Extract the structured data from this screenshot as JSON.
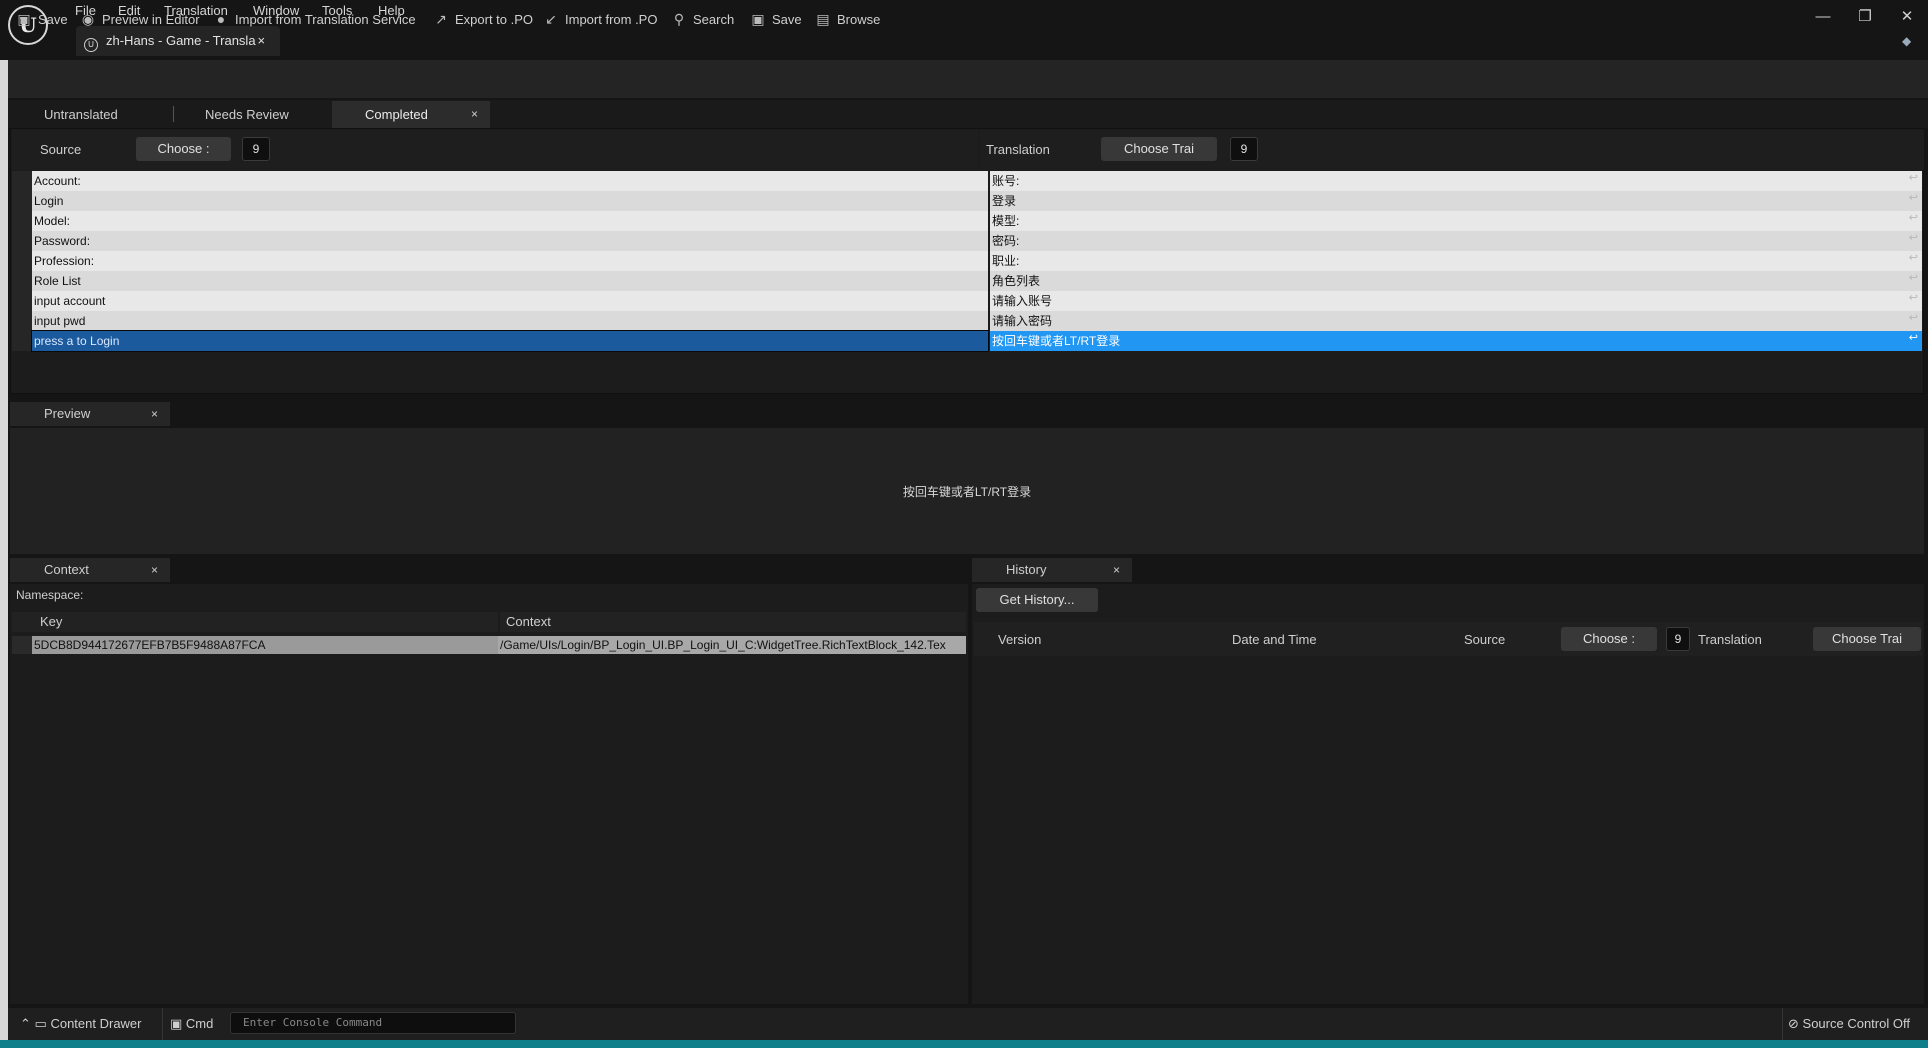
{
  "menu": [
    "File",
    "Edit",
    "Translation",
    "Window",
    "Tools",
    "Help"
  ],
  "document_tab": {
    "title": "zh-Hans - Game - Transla",
    "close": "×"
  },
  "window_controls": {
    "minimize": "—",
    "restore": "❐",
    "close": "✕"
  },
  "toolbar": {
    "save": "Save",
    "preview": "Preview in Editor",
    "import_service": "Import from Translation Service",
    "export_po": "Export to .PO",
    "import_po": "Import from .PO",
    "search": "Search",
    "save2": "Save",
    "browse": "Browse"
  },
  "tabs": {
    "untranslated": "Untranslated",
    "needs_review": "Needs Review",
    "completed": "Completed",
    "close": "×"
  },
  "completed": {
    "source_label": "Source",
    "source_choose": "Choose :",
    "source_num": "9",
    "translation_label": "Translation",
    "translation_choose": "Choose Trai",
    "translation_num": "9",
    "rows": [
      {
        "source": "Account:",
        "translation": "账号:"
      },
      {
        "source": "Login",
        "translation": "登录"
      },
      {
        "source": "Model:",
        "translation": "模型:"
      },
      {
        "source": "Password:",
        "translation": "密码:"
      },
      {
        "source": "Profession:",
        "translation": "职业:"
      },
      {
        "source": "Role List",
        "translation": "角色列表"
      },
      {
        "source": "input account",
        "translation": "请输入账号"
      },
      {
        "source": "input pwd",
        "translation": "请输入密码"
      },
      {
        "source": "press a to Login",
        "translation": "按回车键或者LT/RT登录"
      }
    ],
    "selected_row": 8
  },
  "preview": {
    "tab": "Preview",
    "text": "按回车键或者LT/RT登录"
  },
  "context": {
    "tab": "Context",
    "namespace_label": "Namespace:",
    "key_header": "Key",
    "context_header": "Context",
    "key": "5DCB8D944172677EFB7B5F9488A87FCA",
    "context_value": "/Game/UIs/Login/BP_Login_UI.BP_Login_UI_C:WidgetTree.RichTextBlock_142.Tex"
  },
  "history": {
    "tab": "History",
    "get_history": "Get History...",
    "version": "Version",
    "date_time": "Date and Time",
    "source": "Source",
    "source_choose": "Choose :",
    "source_num": "9",
    "translation": "Translation",
    "translation_choose": "Choose Trai"
  },
  "status": {
    "content_drawer": "Content Drawer",
    "cmd": "Cmd",
    "console_placeholder": "Enter Console Command",
    "source_control": "Source Control Off"
  }
}
